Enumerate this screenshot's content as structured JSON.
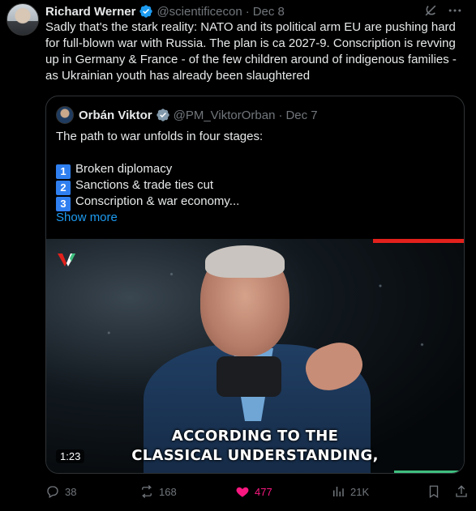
{
  "tweet": {
    "author_name": "Richard Werner",
    "author_handle": "@scientificecon",
    "date": "Dec 8",
    "separator": "·",
    "text": "Sadly that's the stark reality: NATO and its political arm EU are pushing hard for full-blown war with Russia. The plan is ca 2027-9. Conscription is revving up in Germany & France - of the few children around of indigenous families - as Ukrainian youth has already been slaughtered"
  },
  "quoted": {
    "author_name": "Orbán Viktor",
    "author_handle": "@PM_ViktorOrban",
    "date": "Dec 7",
    "separator": "·",
    "intro": "The path to war unfolds in four stages:",
    "stages": [
      {
        "number": "1",
        "text": "Broken diplomacy"
      },
      {
        "number": "2",
        "text": "Sanctions & trade ties cut"
      },
      {
        "number": "3",
        "text": "Conscription & war economy..."
      }
    ],
    "show_more": "Show more",
    "video": {
      "caption_line1": "ACCORDING TO THE",
      "caption_line2": "CLASSICAL UNDERSTANDING,",
      "duration": "1:23"
    }
  },
  "actions": {
    "replies": "38",
    "reposts": "168",
    "likes": "477",
    "views": "21K"
  },
  "colors": {
    "accent": "#1d9bf0",
    "like": "#f91880",
    "muted": "#71767b",
    "border": "#2f3336",
    "background": "#000000"
  },
  "icons": [
    "verified-badge-icon",
    "grok-icon",
    "more-icon",
    "reply-icon",
    "repost-icon",
    "like-icon",
    "views-icon",
    "bookmark-icon",
    "share-icon"
  ]
}
